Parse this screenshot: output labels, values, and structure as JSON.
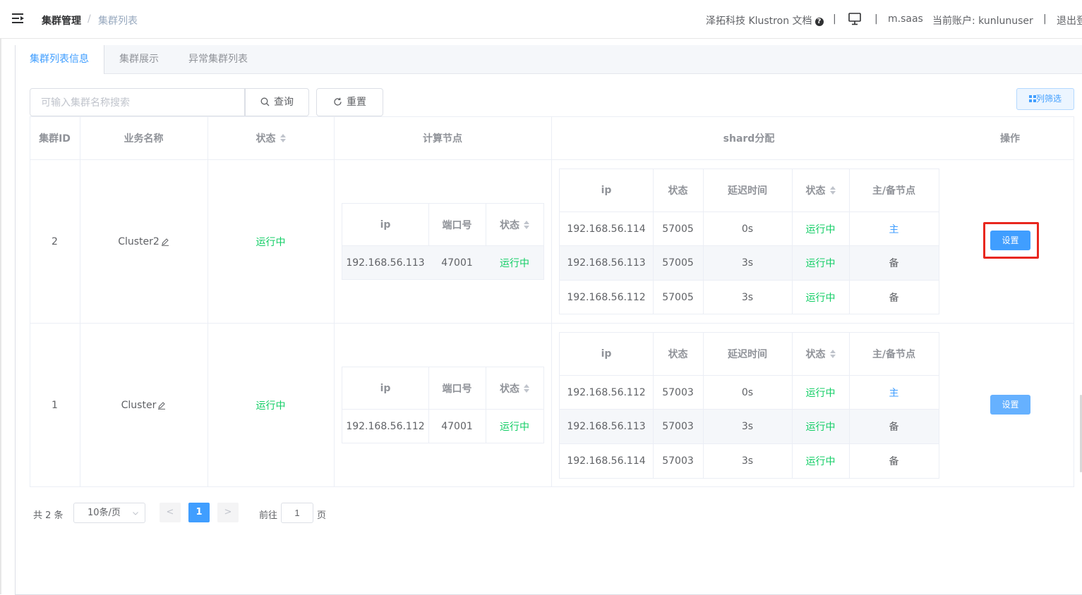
{
  "header": {
    "breadcrumb": [
      "集群管理",
      "集群列表"
    ],
    "breadcrumb_sep": "/",
    "docs_link": "泽拓科技 Klustron 文档",
    "help_glyph": "?",
    "separator": "|",
    "tenant": "m.saas",
    "current_account_label": "当前账户:",
    "current_account": "kunlunuser",
    "logout": "退出登"
  },
  "tabs": [
    {
      "label": "集群列表信息",
      "active": true
    },
    {
      "label": "集群展示",
      "active": false
    },
    {
      "label": "异常集群列表",
      "active": false
    }
  ],
  "toolbar": {
    "search_placeholder": "可输入集群名称搜索",
    "query_label": "查询",
    "reset_label": "重置",
    "column_filter_label": "列筛选"
  },
  "table": {
    "headers": {
      "id": "集群ID",
      "name": "业务名称",
      "status": "状态",
      "compute": "计算节点",
      "shard": "shard分配",
      "action": "操作"
    },
    "compute_headers": [
      "ip",
      "端口号",
      "状态"
    ],
    "shard_headers": [
      "ip",
      "状态",
      "延迟时间",
      "状态",
      "主/备节点"
    ],
    "rows": [
      {
        "id": "2",
        "name": "Cluster2",
        "status": "运行中",
        "compute": [
          {
            "ip": "192.168.56.113",
            "port": "47001",
            "status": "运行中"
          }
        ],
        "shards": [
          {
            "ip": "192.168.56.114",
            "port": "57005",
            "delay": "0s",
            "status": "运行中",
            "role": "主"
          },
          {
            "ip": "192.168.56.113",
            "port": "57005",
            "delay": "3s",
            "status": "运行中",
            "role": "备"
          },
          {
            "ip": "192.168.56.112",
            "port": "57005",
            "delay": "3s",
            "status": "运行中",
            "role": "备"
          }
        ],
        "action": "设置"
      },
      {
        "id": "1",
        "name": "Cluster",
        "status": "运行中",
        "compute": [
          {
            "ip": "192.168.56.112",
            "port": "47001",
            "status": "运行中"
          }
        ],
        "shards": [
          {
            "ip": "192.168.56.112",
            "port": "57003",
            "delay": "0s",
            "status": "运行中",
            "role": "主"
          },
          {
            "ip": "192.168.56.113",
            "port": "57003",
            "delay": "3s",
            "status": "运行中",
            "role": "备"
          },
          {
            "ip": "192.168.56.114",
            "port": "57003",
            "delay": "3s",
            "status": "运行中",
            "role": "备"
          }
        ],
        "action": "设置"
      }
    ]
  },
  "pagination": {
    "total_text": "共 2 条",
    "page_size": "10条/页",
    "prev": "<",
    "current_page": "1",
    "next": ">",
    "goto_label": "前往",
    "goto_value": "1",
    "page_suffix": "页"
  },
  "colors": {
    "primary": "#409eff",
    "running": "#13ce66",
    "highlight_box": "#e8271e"
  }
}
